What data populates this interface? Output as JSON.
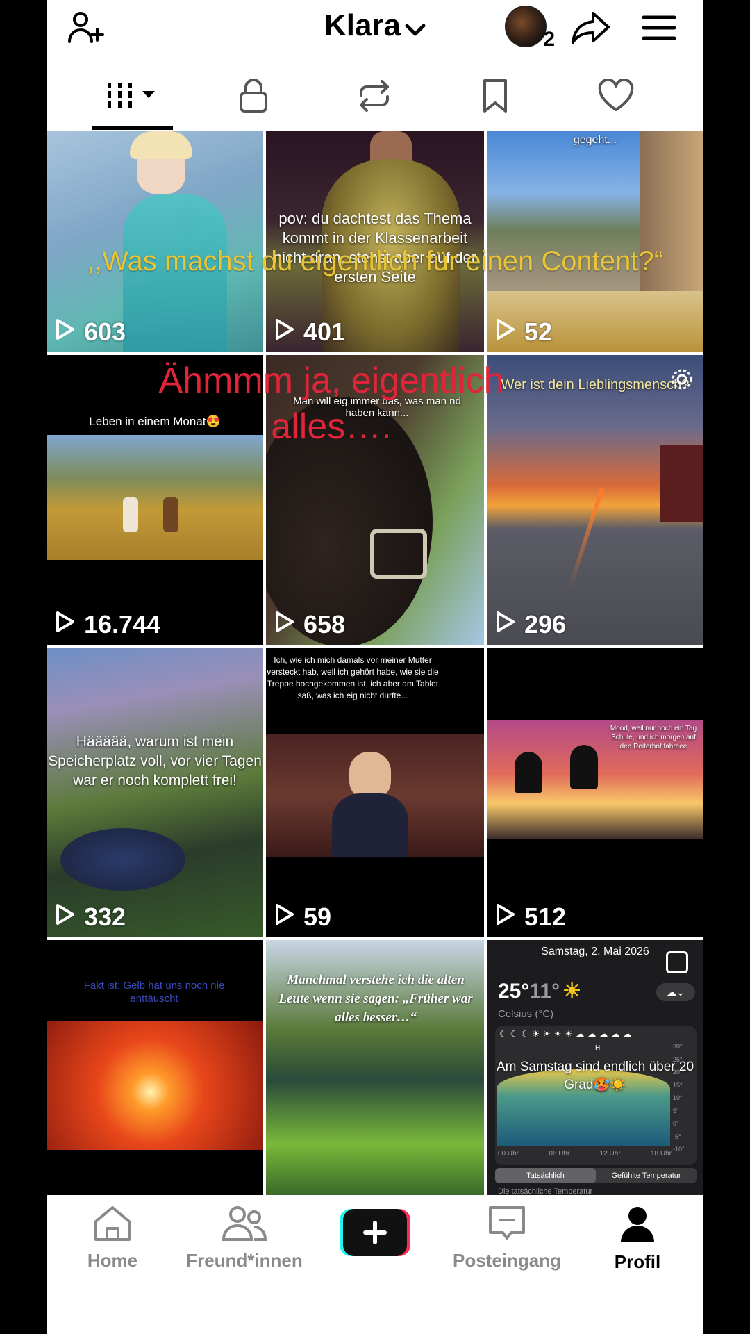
{
  "header": {
    "username": "Klara",
    "avatar_badge": "2",
    "icons": [
      "add-friend-icon",
      "chevron-down-icon",
      "share-icon",
      "menu-icon"
    ]
  },
  "tabs": [
    {
      "name": "videos",
      "icon": "grid-icon",
      "active": true
    },
    {
      "name": "private",
      "icon": "lock-icon",
      "active": false
    },
    {
      "name": "reposts",
      "icon": "repost-icon",
      "active": false
    },
    {
      "name": "saved",
      "icon": "bookmark-icon",
      "active": false
    },
    {
      "name": "liked",
      "icon": "heart-icon",
      "active": false
    }
  ],
  "overlay": {
    "yellow_text": ",,Was machst du eigentlich für einen Content?“",
    "red_text": "Ähmmm ja, eigentlich alles…."
  },
  "videos": [
    {
      "views": "603",
      "caption": ""
    },
    {
      "views": "401",
      "caption": "pov: du dachtest das Thema kommt in der Klassenarbeit nicht dran, stehst aber auf der ersten Seite"
    },
    {
      "views": "52",
      "caption": "gegeht..."
    },
    {
      "views": "16.744",
      "caption": "Leben in einem Monat😍"
    },
    {
      "views": "658",
      "caption": "Man will eig immer das, was man nd haben kann..."
    },
    {
      "views": "296",
      "caption": "Wer ist dein Lieblingsmensch?"
    },
    {
      "views": "332",
      "caption": "Häääää, warum ist mein Speicherplatz voll, vor vier Tagen war er noch komplett frei!"
    },
    {
      "views": "59",
      "caption": "Ich, wie ich mich damals vor meiner Mutter versteckt hab, weil ich gehört habe, wie sie die Treppe hochgekommen ist, ich aber am Tablet saß, was ich eig nicht durfte..."
    },
    {
      "views": "512",
      "caption": "Mood, weil nur noch ein Tag Schule, und ich morgen auf den Reiterhof fahreee"
    },
    {
      "views": "",
      "caption": "Fakt ist: Gelb hat uns noch nie enttäuscht"
    },
    {
      "views": "",
      "caption": "Manchmal verstehe ich die alten Leute wenn sie sagen: „Früher war alles besser…“"
    },
    {
      "views": "",
      "caption": "Am Samstag sind endlich über 20 Grad🥵☀️"
    }
  ],
  "weather": {
    "date": "Samstag, 2. Mai 2026",
    "temp_high": "25°",
    "temp_low": "11°",
    "unit": "Celsius (°C)",
    "y_ticks": [
      "30°",
      "25°",
      "20°",
      "15°",
      "10°",
      "5°",
      "0°",
      "-5°",
      "-10°"
    ],
    "x_ticks": [
      "00 Uhr",
      "06 Uhr",
      "12 Uhr",
      "18 Uhr"
    ],
    "h_marker": "H",
    "seg_actual": "Tatsächlich",
    "seg_felt": "Gefühlte Temperatur",
    "footer": "Die tatsächliche Temperatur"
  },
  "bottom_nav": [
    {
      "label": "Home",
      "icon": "home-icon",
      "active": false
    },
    {
      "label": "Freund*innen",
      "icon": "friends-icon",
      "active": false
    },
    {
      "label": "Posteingang",
      "icon": "inbox-icon",
      "active": false
    },
    {
      "label": "Profil",
      "icon": "profile-icon",
      "active": true
    }
  ],
  "colors": {
    "overlay_yellow": "#e8c537",
    "overlay_red": "#e0243a",
    "plus_cyan": "#25f4ee",
    "plus_pink": "#fe2c55"
  }
}
